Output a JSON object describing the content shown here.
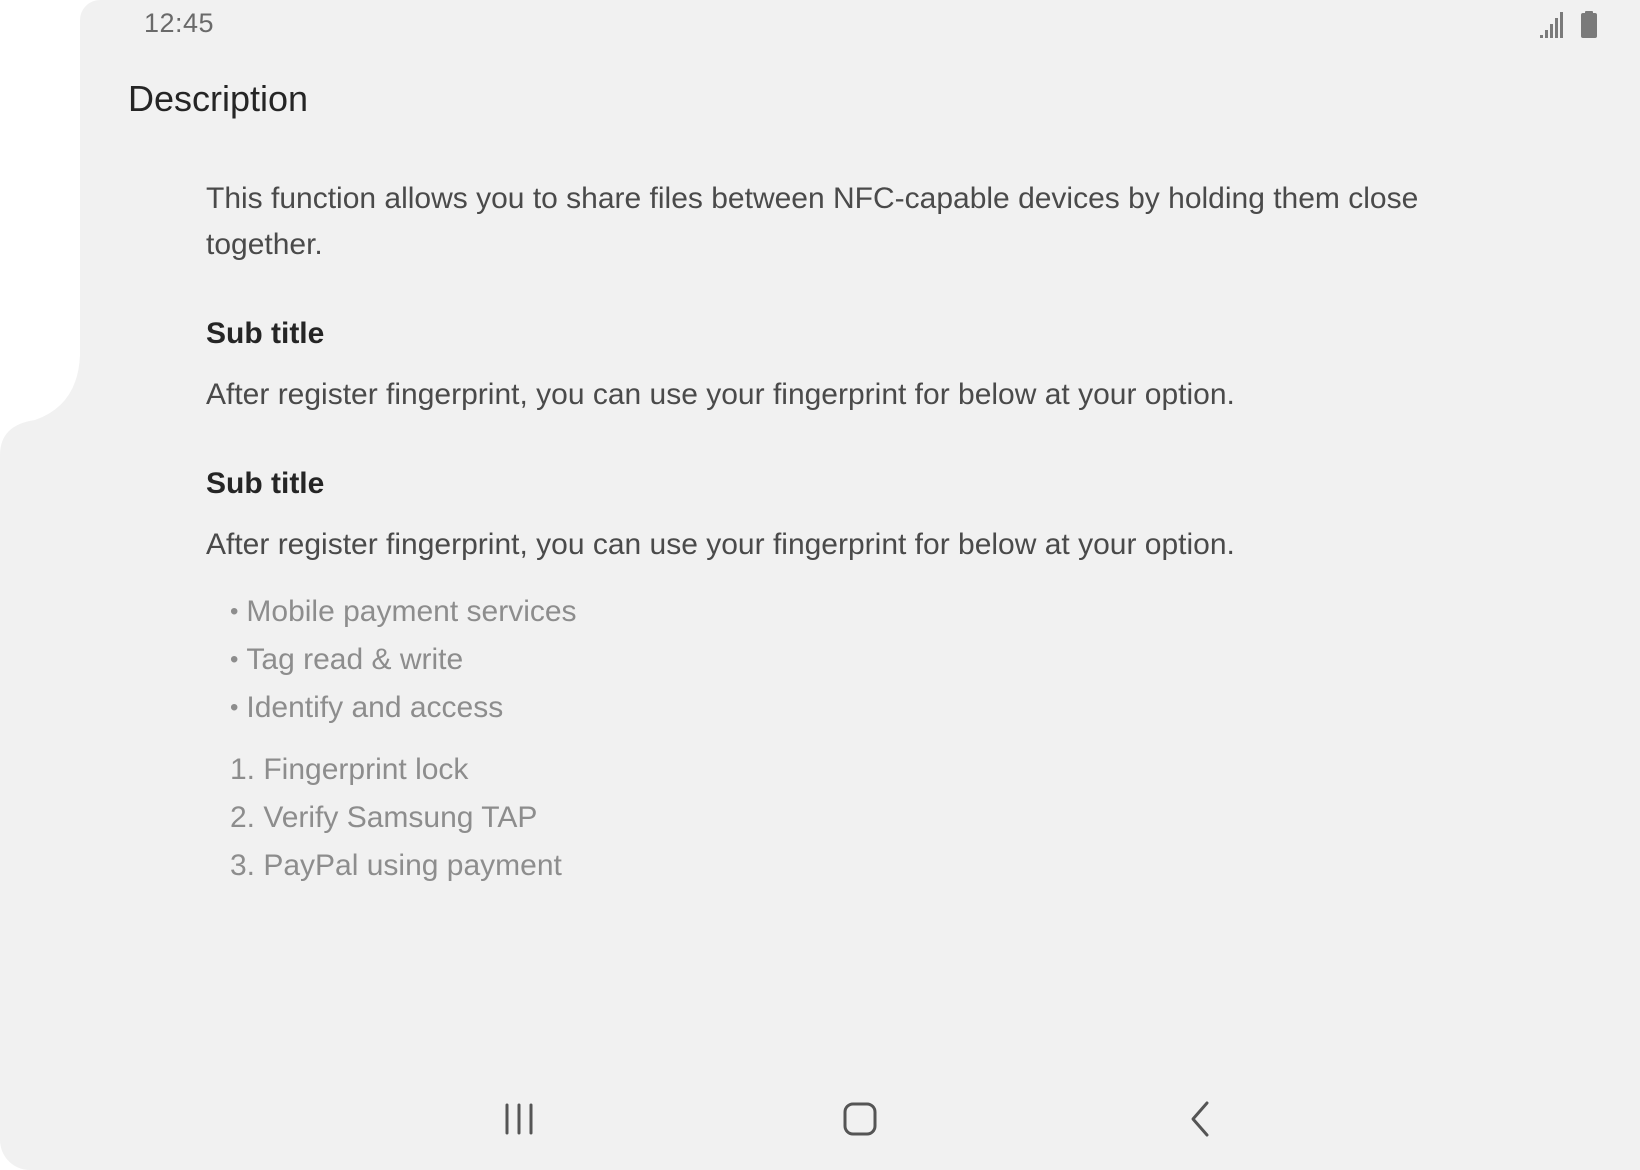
{
  "status_bar": {
    "time": "12:45"
  },
  "page": {
    "title": "Description",
    "intro": "This function allows you to share files between NFC-capable devices by holding them close together.",
    "sections": [
      {
        "subtitle": "Sub title",
        "body": "After register fingerprint, you can use your fingerprint for below at your option."
      },
      {
        "subtitle": "Sub title",
        "body": "After register fingerprint, you can use your fingerprint for below at your option."
      }
    ],
    "bullets": [
      "Mobile payment services",
      "Tag read & write",
      "Identify and access"
    ],
    "numbered": [
      "1. Fingerprint lock",
      "2. Verify Samsung TAP",
      "3. PayPal using payment"
    ]
  },
  "nav_bar": {
    "recents_icon": "recents-icon",
    "home_icon": "home-icon",
    "back_icon": "back-icon"
  },
  "colors": {
    "background": "#f1f1f1",
    "title": "#252525",
    "body": "#4a4a4a",
    "muted": "#8d8d8d"
  }
}
